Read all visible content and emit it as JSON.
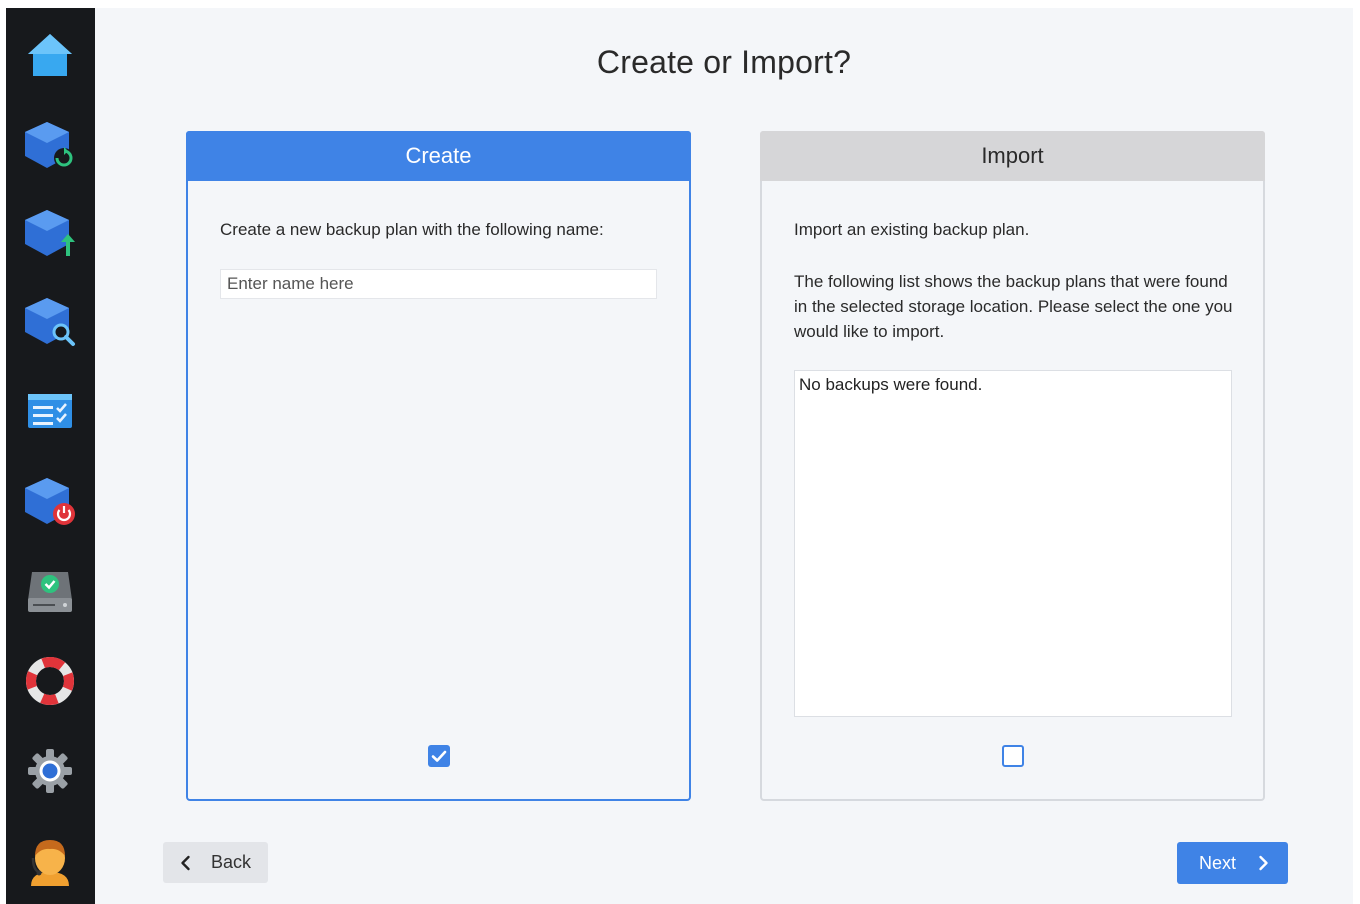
{
  "sidebar": {
    "items": [
      {
        "icon": "home-icon"
      },
      {
        "icon": "backup-sync-icon"
      },
      {
        "icon": "backup-upload-icon"
      },
      {
        "icon": "backup-search-icon"
      },
      {
        "icon": "task-list-icon"
      },
      {
        "icon": "backup-power-icon"
      },
      {
        "icon": "drive-check-icon"
      },
      {
        "icon": "lifebuoy-icon"
      },
      {
        "icon": "gear-icon"
      },
      {
        "icon": "user-avatar-icon"
      }
    ]
  },
  "page": {
    "title": "Create or Import?"
  },
  "create": {
    "header": "Create",
    "description": "Create a new backup plan with the following name:",
    "input_placeholder": "Enter name here",
    "input_value": "",
    "checked": true
  },
  "import": {
    "header": "Import",
    "description": "Import an existing backup plan.",
    "details": "The following list shows the backup plans that were found in the selected storage location. Please select the one you would like to import.",
    "empty_list_text": "No backups were found.",
    "checked": false
  },
  "footer": {
    "back_label": "Back",
    "next_label": "Next"
  },
  "colors": {
    "accent": "#3f83e6",
    "sidebar_bg": "#17191c",
    "content_bg": "#f4f6f9"
  }
}
